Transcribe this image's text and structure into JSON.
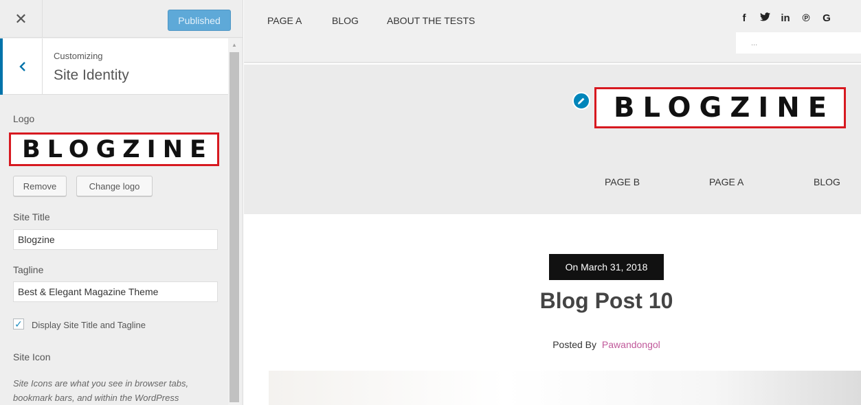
{
  "sidebar": {
    "close_icon": "close-icon",
    "publish_label": "Published",
    "panel": {
      "parent_label": "Customizing",
      "title": "Site Identity"
    },
    "logo": {
      "label": "Logo",
      "image_text": "BLOGZINE",
      "remove_label": "Remove",
      "change_label": "Change logo"
    },
    "site_title": {
      "label": "Site Title",
      "value": "Blogzine"
    },
    "tagline": {
      "label": "Tagline",
      "value": "Best & Elegant Magazine Theme"
    },
    "display_title_tagline": {
      "label": "Display Site Title and Tagline",
      "checked": true
    },
    "site_icon": {
      "label": "Site Icon",
      "description": "Site Icons are what you see in browser tabs, bookmark bars, and within the WordPress"
    }
  },
  "preview": {
    "top_nav": [
      "PAGE A",
      "BLOG",
      "ABOUT THE TESTS"
    ],
    "social": [
      "f",
      "🐦",
      "in",
      "℗",
      "G"
    ],
    "search_placeholder": "...",
    "logo_text": "BLOGZINE",
    "main_nav": [
      "PAGE B",
      "PAGE A",
      "BLOG"
    ],
    "post": {
      "date": "On March 31, 2018",
      "title": "Blog Post 10",
      "posted_by_label": "Posted By",
      "author": "Pawandongol"
    }
  },
  "colors": {
    "accent": "#0073aa",
    "publish_button": "#5ea9d8",
    "highlight_box": "#d71920",
    "author_link": "#c0589a"
  }
}
